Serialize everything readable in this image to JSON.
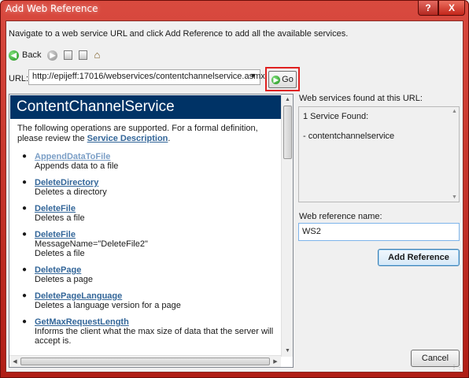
{
  "window": {
    "title": "Add Web Reference",
    "help_glyph": "?",
    "close_glyph": "X"
  },
  "instructions": "Navigate to a web service URL and click Add Reference to add all the available services.",
  "nav": {
    "back_label": "Back",
    "icons": [
      "back-arrow-icon",
      "forward-arrow-icon",
      "stop-icon",
      "refresh-icon",
      "home-icon"
    ]
  },
  "url": {
    "label": "URL:",
    "value": "http://epijeff:17016/webservices/contentchannelservice.asmx",
    "go_label": "Go"
  },
  "browser": {
    "service_name": "ContentChannelService",
    "intro_text": "The following operations are supported. For a formal definition, please review the ",
    "intro_link": "Service Description",
    "intro_end": ".",
    "operations": [
      {
        "name": "AppendDataToFile",
        "desc": "Appends data to a file",
        "extra": ""
      },
      {
        "name": "DeleteDirectory",
        "desc": "Deletes a directory",
        "extra": ""
      },
      {
        "name": "DeleteFile",
        "desc": "Deletes a file",
        "extra": ""
      },
      {
        "name": "DeleteFile",
        "desc": "Deletes a file",
        "extra": "MessageName=\"DeleteFile2\""
      },
      {
        "name": "DeletePage",
        "desc": "Deletes a page",
        "extra": ""
      },
      {
        "name": "DeletePageLanguage",
        "desc": "Deletes a language version for a page",
        "extra": ""
      },
      {
        "name": "GetMaxRequestLength",
        "desc": "Informs the client what the max size of data that the server will accept is.",
        "extra": ""
      }
    ]
  },
  "found": {
    "label": "Web services found at this URL:",
    "count": "1 Service Found:",
    "item": "- contentchannelservice"
  },
  "reference": {
    "label": "Web reference name:",
    "value": "WS2",
    "add_label": "Add Reference"
  },
  "cancel_label": "Cancel",
  "colors": {
    "title_bar": "#c4271d",
    "service_header": "#003366",
    "link": "#336699",
    "go_highlight": "#e0201f"
  }
}
